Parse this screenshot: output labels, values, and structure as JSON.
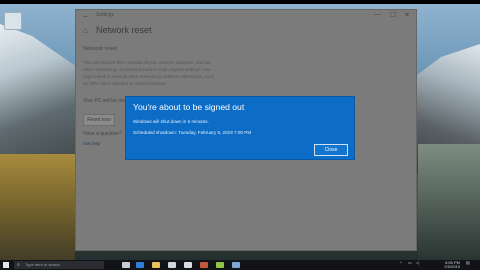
{
  "settings_window": {
    "title": "Settings",
    "page_title": "Network reset",
    "section_title": "Network reset",
    "description_lines": [
      "This will remove then reinstall all your network adapters, and set",
      "other networking components back to their original settings. You",
      "might need to reinstall other networking software afterwards, such",
      "as VPN client software or virtual switches."
    ],
    "restart_note": "Your PC will be restarted.",
    "reset_button_label": "Reset now",
    "question": "Have a question?",
    "help_link": "Get help",
    "controls": {
      "minimize": "—",
      "maximize": "☐",
      "close": "✕",
      "back": "←",
      "home": "⌂"
    }
  },
  "dialog": {
    "title": "You're about to be signed out",
    "subtitle": "Windows will shut down in 5 minutes.",
    "time_line": "Scheduled shutdown: Tuesday, February 5, 2019 7:00 PM",
    "close_button_label": "Close"
  },
  "taskbar": {
    "search_placeholder": "Type here to search",
    "clock_time": "6:55 PM",
    "clock_date": "2/5/2019",
    "colors": {
      "background": "#111317",
      "dialog": "#0d6dc6"
    }
  }
}
